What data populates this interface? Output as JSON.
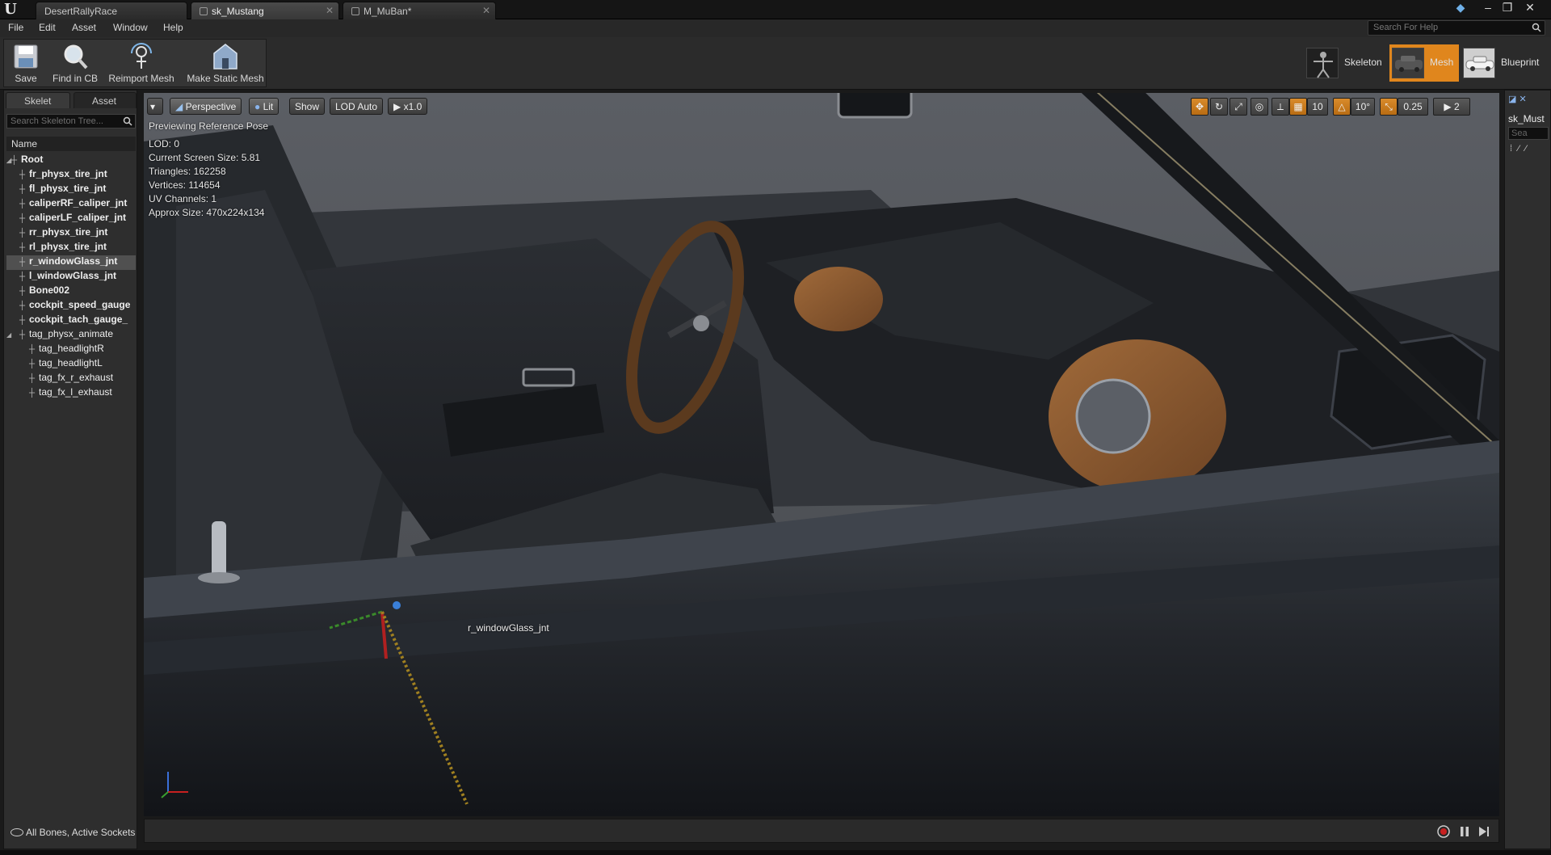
{
  "window": {
    "tabs": [
      {
        "label": "DesertRallyRace"
      },
      {
        "label": "sk_Mustang"
      },
      {
        "label": "M_MuBan*"
      }
    ]
  },
  "menu": {
    "items": [
      "File",
      "Edit",
      "Asset",
      "Window",
      "Help"
    ],
    "help_search_placeholder": "Search For Help"
  },
  "toolbar": {
    "save_label": "Save",
    "find_label": "Find in CB",
    "reimport_label": "Reimport Mesh",
    "make_static_label": "Make Static Mesh"
  },
  "modes": {
    "skeleton_label": "Skeleton",
    "mesh_label": "Mesh",
    "blueprint_label": "Blueprint",
    "active_color": "#e0861d"
  },
  "left_panel": {
    "tab_skeleton": "Skelet",
    "tab_asset": "Asset",
    "search_placeholder": "Search Skeleton Tree...",
    "column_name": "Name",
    "bones": [
      {
        "label": "Root",
        "bold": true
      },
      {
        "label": "fr_physx_tire_jnt",
        "bold": true
      },
      {
        "label": "fl_physx_tire_jnt",
        "bold": true
      },
      {
        "label": "caliperRF_caliper_jnt",
        "bold": true
      },
      {
        "label": "caliperLF_caliper_jnt",
        "bold": true
      },
      {
        "label": "rr_physx_tire_jnt",
        "bold": true
      },
      {
        "label": "rl_physx_tire_jnt",
        "bold": true
      },
      {
        "label": "r_windowGlass_jnt",
        "bold": true,
        "selected": true
      },
      {
        "label": "l_windowGlass_jnt",
        "bold": true
      },
      {
        "label": "Bone002",
        "bold": true
      },
      {
        "label": "cockpit_speed_gauge",
        "bold": true
      },
      {
        "label": "cockpit_tach_gauge_",
        "bold": true
      },
      {
        "label": "tag_physx_animate",
        "bold": false
      },
      {
        "label": "tag_headlightR",
        "bold": false
      },
      {
        "label": "tag_headlightL",
        "bold": false
      },
      {
        "label": "tag_fx_r_exhaust",
        "bold": false
      },
      {
        "label": "tag_fx_l_exhaust",
        "bold": false
      }
    ],
    "footer": "All Bones, Active Sockets"
  },
  "viewport": {
    "perspective_label": "Perspective",
    "lit_label": "Lit",
    "show_label": "Show",
    "lod_label": "LOD Auto",
    "speed_label": "x1.0",
    "preview_text": "Previewing Reference Pose",
    "stats": [
      "LOD: 0",
      "Current Screen Size: 5.81",
      "Triangles: 162258",
      "Vertices: 114654",
      "UV Channels: 1",
      "Approx Size: 470x224x134"
    ],
    "selected_bone_label": "r_windowGlass_jnt",
    "grid_snap": "10",
    "rot_snap": "10°",
    "scale_snap": "0.25",
    "camera_speed": "2"
  },
  "right_panel": {
    "title": "sk_Must",
    "search_placeholder": "Sea"
  }
}
